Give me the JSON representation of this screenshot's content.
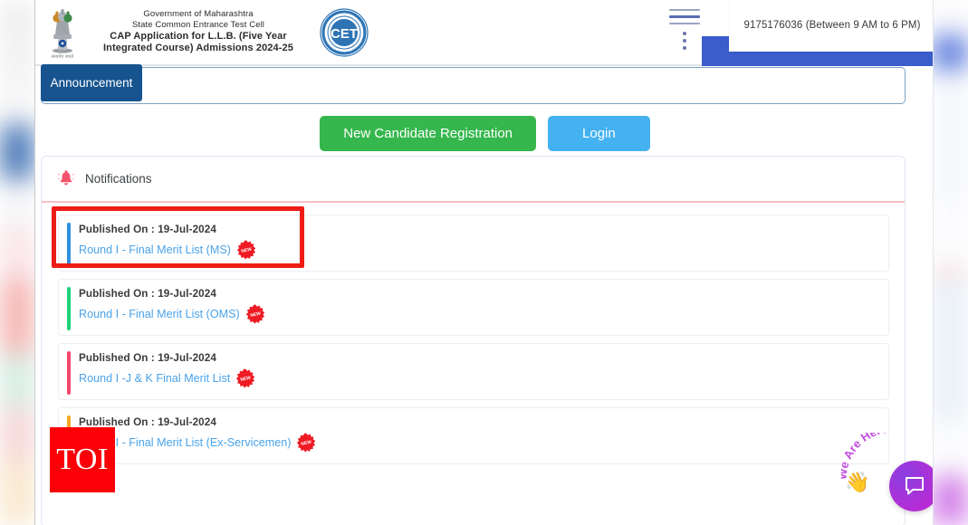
{
  "header": {
    "emblem_icon": "india-national-emblem",
    "emblem_caption": "सत्यमेव जयते",
    "title_line1": "Government of Maharashtra",
    "title_line2": "State Common Entrance Test Cell",
    "title_line3": "CAP Application for L.L.B. (Five Year",
    "title_line4": "Integrated Course) Admissions 2024-25",
    "cet_logo_icon": "cet-seal-logo",
    "cet_logo_text": "CET",
    "cet_logo_ring_text": "STATE COMMON ENTRANCE TEST CELL",
    "hamburger_icon": "hamburger-menu-icon",
    "kebab_icon": "vertical-dots-menu-icon",
    "helpline": "9175176036 (Between 9 AM to 6 PM)",
    "blue_block_color": "#3a5ccc"
  },
  "announcement": {
    "tab_label": "Announcement",
    "tab_color": "#17548f",
    "message": ""
  },
  "actions": {
    "register_label": "New Candidate Registration",
    "register_color": "#35b74d",
    "login_label": "Login",
    "login_color": "#44b2f0"
  },
  "notifications": {
    "bell_icon": "bell-icon",
    "heading": "Notifications",
    "divider_color": "#f6bfc4",
    "scrollbar_color": "#17548f",
    "badge_icon": "new-starburst-badge",
    "badge_label": "NEW",
    "items": [
      {
        "published_label": "Published On : 19-Jul-2024",
        "link": "Round I - Final Merit List (MS)",
        "accent_color": "#2d8fe0",
        "badge": "NEW",
        "highlighted": true
      },
      {
        "published_label": "Published On : 19-Jul-2024",
        "link": "Round I - Final Merit List (OMS)",
        "accent_color": "#1fd17a",
        "badge": "NEW",
        "highlighted": false
      },
      {
        "published_label": "Published On : 19-Jul-2024",
        "link": "Round I -J & K Final Merit List",
        "accent_color": "#f4476b",
        "badge": "NEW",
        "highlighted": false
      },
      {
        "published_label": "Published On : 19-Jul-2024",
        "link": "Round I - Final Merit List (Ex-Servicemen)",
        "accent_color": "#f5a623",
        "badge": "NEW",
        "highlighted": false
      }
    ],
    "annotation_color": "#ed1c16"
  },
  "watermark": {
    "text": "TOI",
    "color": "#fb0007"
  },
  "chat": {
    "arc_text": "We Are Here!",
    "wave_icon": "waving-hand-icon",
    "bubble_icon": "chat-bubble-icon",
    "bubble_color": "#b02fd6"
  }
}
